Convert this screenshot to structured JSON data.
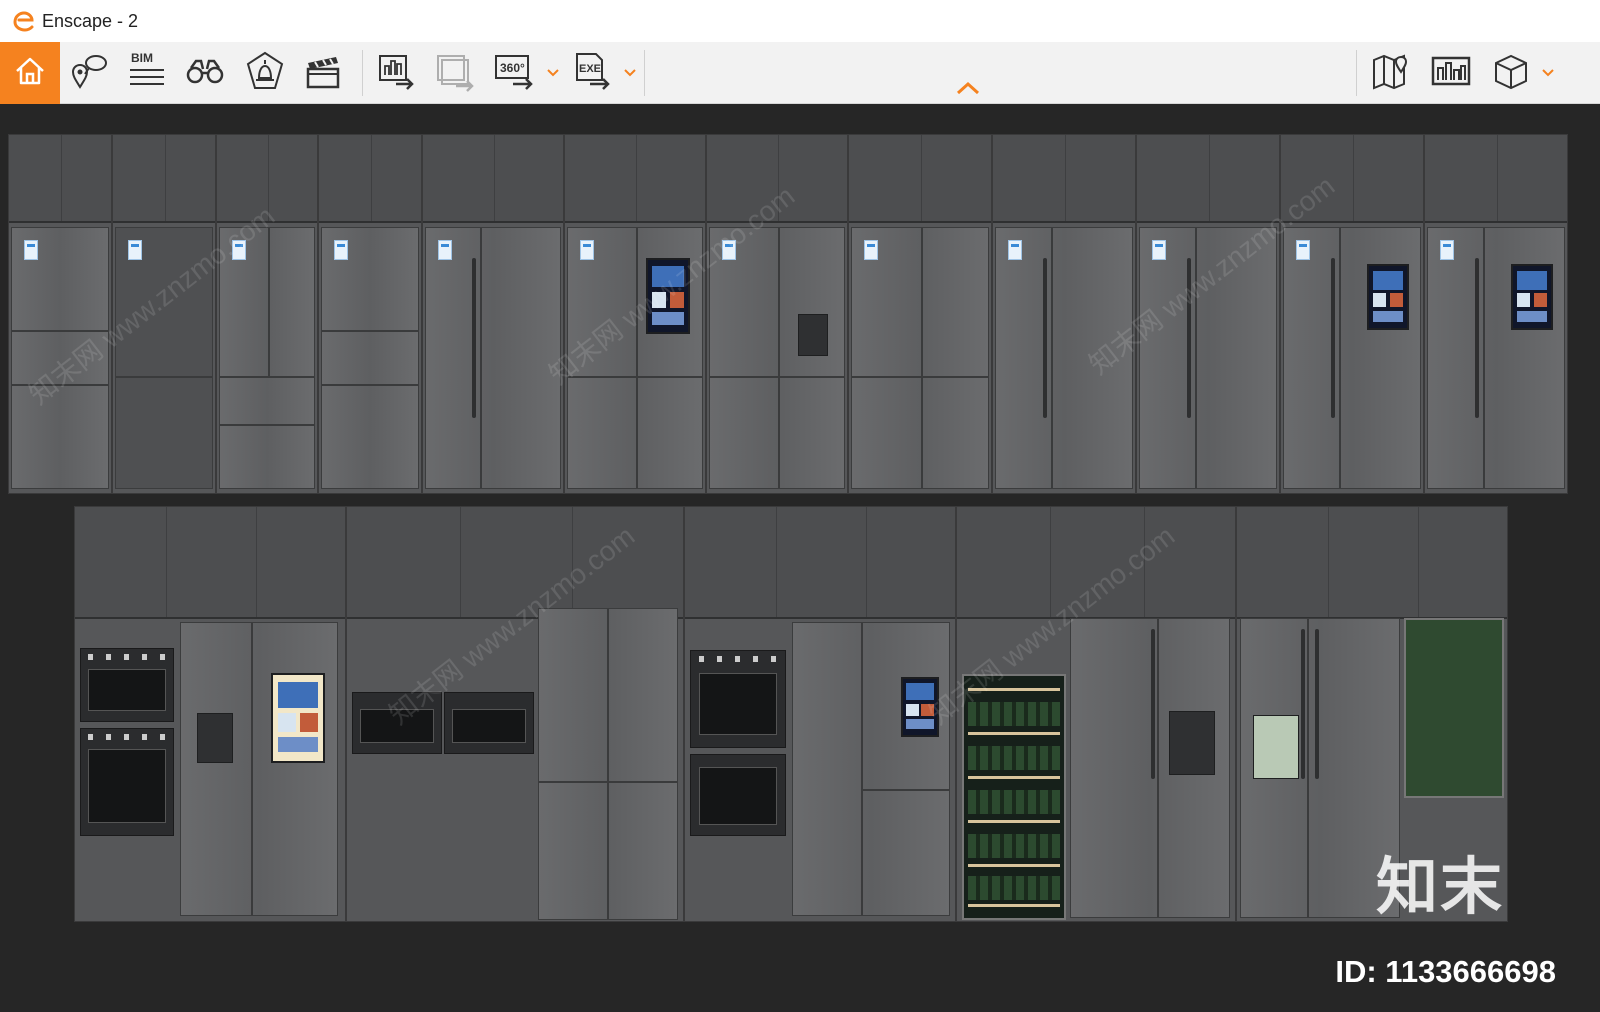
{
  "window": {
    "title": "Enscape - 2",
    "accent_color": "#f5821f"
  },
  "toolbar": {
    "left_tools": [
      {
        "name": "home",
        "icon": "home-icon",
        "active": true
      },
      {
        "name": "views",
        "icon": "location-views-icon"
      },
      {
        "name": "bim",
        "icon": "bim-icon",
        "label": "BIM"
      },
      {
        "name": "binoculars",
        "icon": "binoculars-icon"
      },
      {
        "name": "atmosphere",
        "icon": "atmosphere-icon"
      },
      {
        "name": "video",
        "icon": "clapperboard-icon"
      }
    ],
    "export_tools": [
      {
        "name": "export-image",
        "icon": "export-image-icon"
      },
      {
        "name": "batch-render",
        "icon": "batch-render-icon",
        "disabled": true
      },
      {
        "name": "panorama",
        "icon": "panorama-360-icon",
        "label": "360°"
      },
      {
        "name": "exe",
        "icon": "exe-export-icon",
        "label": "EXE"
      }
    ],
    "right_tools": [
      {
        "name": "map",
        "icon": "map-icon"
      },
      {
        "name": "asset-library",
        "icon": "asset-library-icon"
      },
      {
        "name": "object",
        "icon": "cube-icon"
      }
    ]
  },
  "overlay": {
    "brand_text": "知末",
    "id_text": "ID: 1133666698",
    "watermark_text": "知末网 www.znzmo.com"
  }
}
